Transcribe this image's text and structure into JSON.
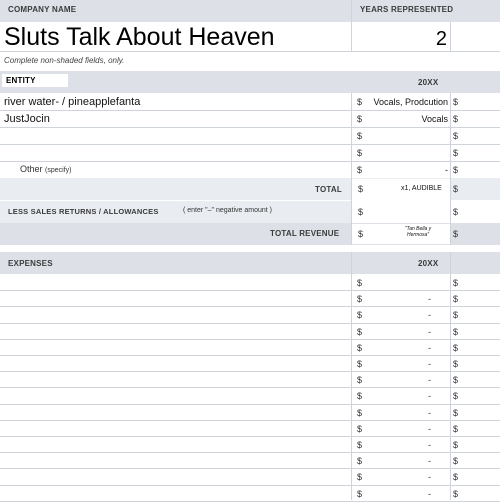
{
  "header": {
    "company_name_label": "COMPANY NAME",
    "years_label": "YEARS REPRESENTED",
    "company_name_value": "Sluts Talk About Heaven",
    "years_value": "2"
  },
  "note": "Complete non-shaded fields, only.",
  "revenue": {
    "entity_label": "ENTITY",
    "year_label": "20XX",
    "rows": [
      {
        "entity": "river water- / pineapplefanta",
        "dollar": "$",
        "value": "Vocals, Prodcution",
        "dollar2": "$"
      },
      {
        "entity": "JustJocin",
        "dollar": "$",
        "value": "Vocals",
        "dollar2": "$"
      },
      {
        "entity": "",
        "dollar": "$",
        "value": "",
        "dollar2": "$"
      },
      {
        "entity": "",
        "dollar": "$",
        "value": "",
        "dollar2": "$"
      },
      {
        "entity": "",
        "dollar": "$",
        "value": "-",
        "dollar2": "$"
      }
    ],
    "other_label": "Other",
    "other_specify": "(specify)",
    "total_label": "TOTAL",
    "total_dollar": "$",
    "total_value": "x1, AUDIBLE",
    "total_dollar2": "$",
    "less_label": "LESS SALES RETURNS / ALLOWANCES",
    "less_hint": "( enter \"–\" negative amount )",
    "less_dollar": "$",
    "less_dollar2": "$",
    "total_revenue_label": "TOTAL REVENUE",
    "total_revenue_dollar": "$",
    "total_revenue_value_line1": "\"Tan Bella y",
    "total_revenue_value_line2": "Hermosa\"",
    "total_revenue_dollar2": "$"
  },
  "expenses": {
    "label": "EXPENSES",
    "year_label": "20XX",
    "rows": [
      {
        "dollar": "$",
        "value": "",
        "dollar2": "$"
      },
      {
        "dollar": "$",
        "value": "-",
        "dollar2": "$"
      },
      {
        "dollar": "$",
        "value": "-",
        "dollar2": "$"
      },
      {
        "dollar": "$",
        "value": "-",
        "dollar2": "$"
      },
      {
        "dollar": "$",
        "value": "-",
        "dollar2": "$"
      },
      {
        "dollar": "$",
        "value": "-",
        "dollar2": "$"
      },
      {
        "dollar": "$",
        "value": "-",
        "dollar2": "$"
      },
      {
        "dollar": "$",
        "value": "-",
        "dollar2": "$"
      },
      {
        "dollar": "$",
        "value": "-",
        "dollar2": "$"
      },
      {
        "dollar": "$",
        "value": "-",
        "dollar2": "$"
      },
      {
        "dollar": "$",
        "value": "-",
        "dollar2": "$"
      },
      {
        "dollar": "$",
        "value": "-",
        "dollar2": "$"
      },
      {
        "dollar": "$",
        "value": "-",
        "dollar2": "$"
      },
      {
        "dollar": "$",
        "value": "-",
        "dollar2": "$"
      }
    ]
  }
}
